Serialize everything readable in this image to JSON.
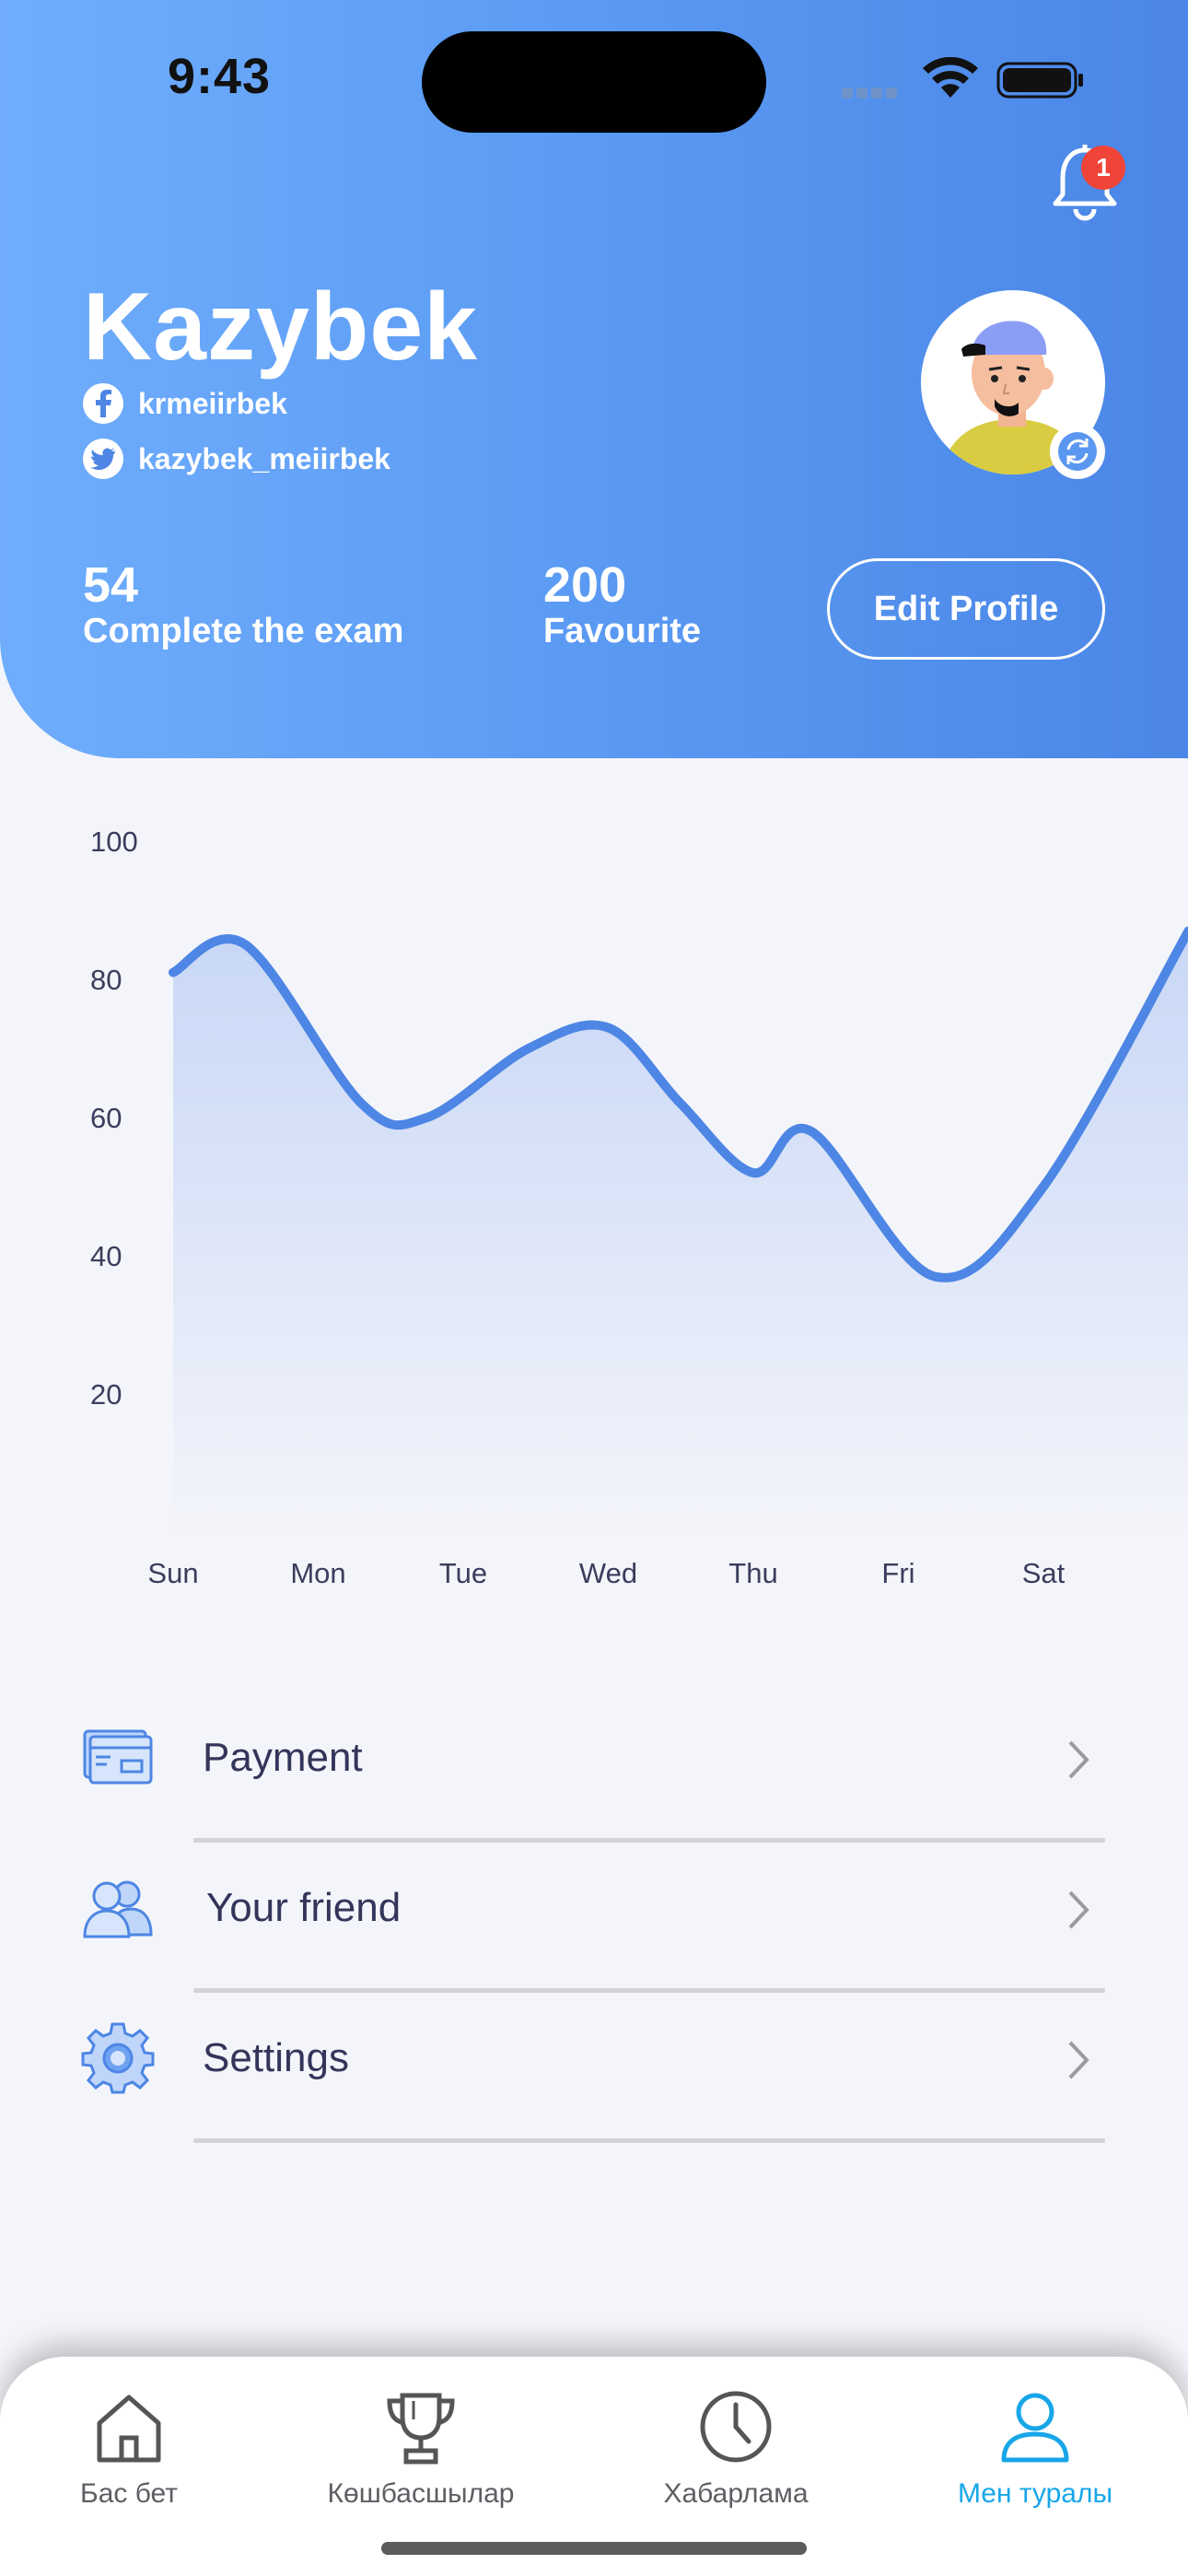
{
  "status_bar": {
    "time": "9:43"
  },
  "notifications": {
    "badge_count": "1"
  },
  "profile": {
    "name": "Kazybek",
    "facebook": "krmeiirbek",
    "twitter": "kazybek_meiirbek",
    "stats": [
      {
        "value": "54",
        "label": "Complete the exam"
      },
      {
        "value": "200",
        "label": "Favourite"
      }
    ],
    "edit_button": "Edit Profile"
  },
  "chart_data": {
    "type": "area",
    "categories": [
      "Sun",
      "Mon",
      "Tue",
      "Wed",
      "Thu",
      "Fri",
      "Sat"
    ],
    "y_ticks": [
      "100",
      "80",
      "60",
      "40",
      "20"
    ],
    "ylim": [
      0,
      100
    ],
    "x": [
      0,
      0.5,
      1.3,
      1.75,
      2.45,
      3.0,
      3.5,
      4.0,
      4.4,
      5.25,
      6.0,
      7.0
    ],
    "values": [
      81,
      85,
      62,
      60,
      70,
      73,
      62,
      52,
      58,
      37,
      50,
      87
    ],
    "line_color": "#4D86E4",
    "fill_color": "#D4E0F8",
    "grid": false
  },
  "menu": [
    {
      "label": "Payment",
      "icon": "credit-card-icon"
    },
    {
      "label": "Your friend",
      "icon": "friends-icon"
    },
    {
      "label": "Settings",
      "icon": "gear-icon"
    }
  ],
  "tabs": [
    {
      "label": "Бас бет",
      "icon": "home-icon",
      "active": false
    },
    {
      "label": "Көшбасшылар",
      "icon": "trophy-icon",
      "active": false
    },
    {
      "label": "Хабарлама",
      "icon": "clock-icon",
      "active": false
    },
    {
      "label": "Мен туралы",
      "icon": "user-icon",
      "active": true
    }
  ],
  "colors": {
    "header_gradient_start": "#6FADFC",
    "header_gradient_end": "#4B86E6",
    "accent": "#17A6E8",
    "text_dark": "#33355A",
    "badge": "#F04438"
  }
}
